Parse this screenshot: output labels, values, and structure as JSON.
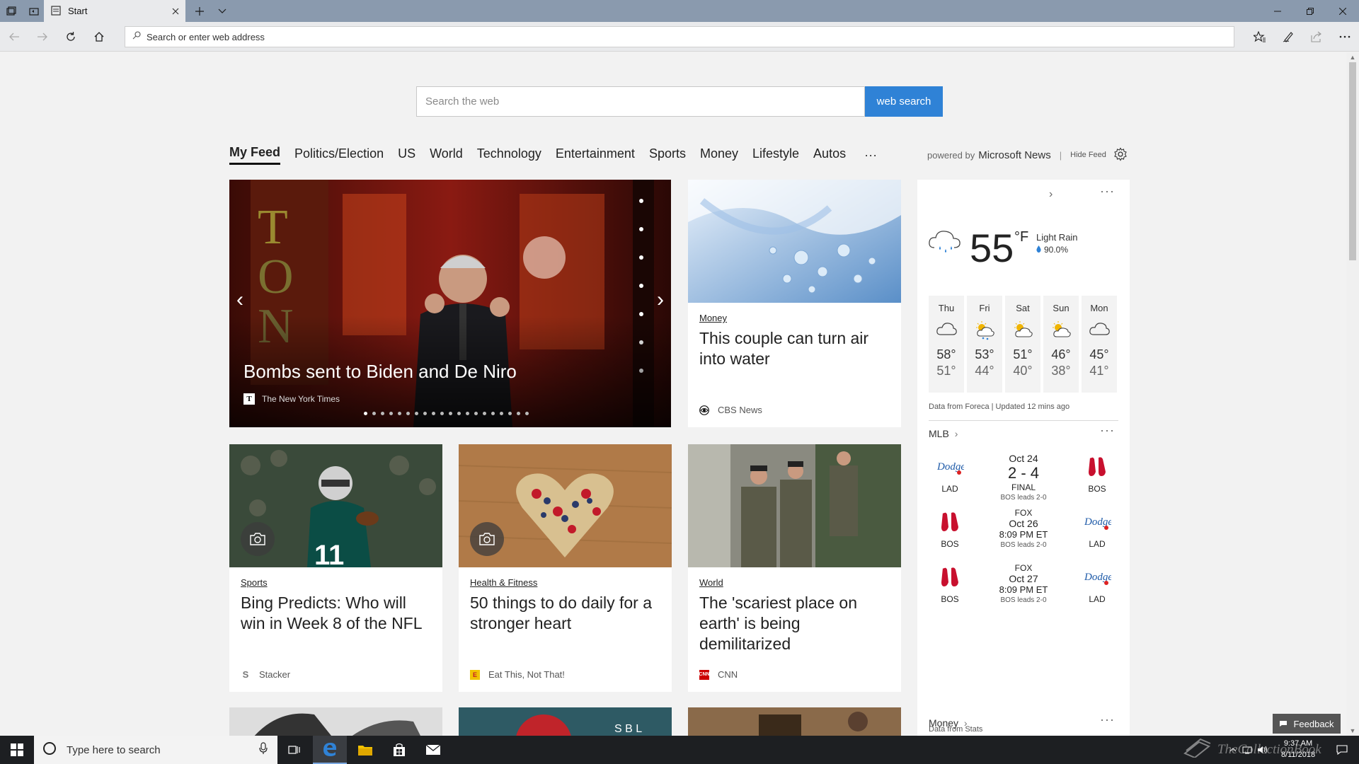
{
  "browser": {
    "tab_title": "Start",
    "address_placeholder": "Search or enter web address"
  },
  "search": {
    "placeholder": "Search the web",
    "button": "web search"
  },
  "feed_nav": {
    "items": [
      "My Feed",
      "Politics/Election",
      "US",
      "World",
      "Technology",
      "Entertainment",
      "Sports",
      "Money",
      "Lifestyle",
      "Autos"
    ],
    "active": "My Feed",
    "more": "···",
    "powered_by": "powered by",
    "powered_brand": "Microsoft News",
    "hide_feed": "Hide Feed"
  },
  "hero": {
    "title": "Bombs sent to Biden and De Niro",
    "source": "The New York Times",
    "source_logo": "T",
    "slide_count": 20,
    "active_slide": 1
  },
  "cards": [
    {
      "category": "Money",
      "title": "This couple can turn air into water",
      "source": "CBS News"
    },
    {
      "category": "Sports",
      "title": "Bing Predicts: Who will win in Week 8 of the NFL",
      "source": "Stacker"
    },
    {
      "category": "Health & Fitness",
      "title": "50 things to do daily for a stronger heart",
      "source": "Eat This, Not That!"
    },
    {
      "category": "World",
      "title": "The 'scariest place on earth' is being demilitarized",
      "source": "CNN"
    }
  ],
  "weather": {
    "temp": "55",
    "unit": "°F",
    "condition": "Light Rain",
    "precip": "90.0%",
    "forecast": [
      {
        "day": "Thu",
        "hi": "58°",
        "lo": "51°",
        "icon": "cloudy-icon"
      },
      {
        "day": "Fri",
        "hi": "53°",
        "lo": "44°",
        "icon": "sun-rain-icon"
      },
      {
        "day": "Sat",
        "hi": "51°",
        "lo": "40°",
        "icon": "partly-sunny-icon"
      },
      {
        "day": "Sun",
        "hi": "46°",
        "lo": "38°",
        "icon": "partly-sunny-icon"
      },
      {
        "day": "Mon",
        "hi": "45°",
        "lo": "41°",
        "icon": "cloudy-icon"
      }
    ],
    "note": "Data from Foreca | Updated 12 mins ago"
  },
  "mlb": {
    "title": "MLB",
    "games": [
      {
        "away": "LAD",
        "home": "BOS",
        "network": "",
        "date": "Oct 24",
        "score": "2 - 4",
        "status": "FINAL",
        "series": "BOS leads 2-0"
      },
      {
        "away": "BOS",
        "home": "LAD",
        "network": "FOX",
        "date": "Oct 26",
        "score": "",
        "status": "8:09 PM ET",
        "series": "BOS leads 2-0"
      },
      {
        "away": "BOS",
        "home": "LAD",
        "network": "FOX",
        "date": "Oct 27",
        "score": "",
        "status": "8:09 PM ET",
        "series": "BOS leads 2-0"
      }
    ],
    "note": "Data from Stats"
  },
  "money_module": {
    "title": "Money"
  },
  "feedback": "Feedback",
  "taskbar": {
    "search_placeholder": "Type here to search",
    "time": "9:37 AM",
    "date": "8/11/2018"
  },
  "watermark": "TheCollectionBook",
  "colors": {
    "accent": "#2f82d6",
    "titlebar": "#8a9aae",
    "taskbar": "#1d1f22"
  }
}
